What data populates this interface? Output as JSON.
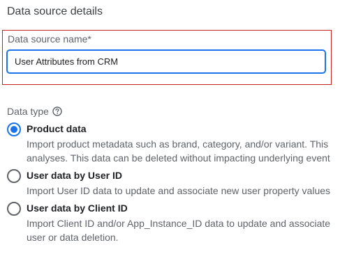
{
  "section": {
    "title": "Data source details"
  },
  "name_field": {
    "label": "Data source name*",
    "value": "User Attributes from CRM"
  },
  "data_type": {
    "label": "Data type",
    "help_icon": "help-circle-icon",
    "options": [
      {
        "title": "Product data",
        "selected": true,
        "desc_line1": "Import product metadata such as brand, category, and/or variant. This",
        "desc_line2": "analyses. This data can be deleted without impacting underlying event"
      },
      {
        "title": "User data by User ID",
        "selected": false,
        "desc_line1": "Import User ID data to update and associate new user property values"
      },
      {
        "title": "User data by Client ID",
        "selected": false,
        "desc_line1": "Import Client ID and/or App_Instance_ID data to update and associate",
        "desc_line2": "user or data deletion."
      }
    ]
  },
  "colors": {
    "accent": "#1a73e8",
    "highlight_border": "#c5221f",
    "secondary_text": "#5f6368"
  }
}
